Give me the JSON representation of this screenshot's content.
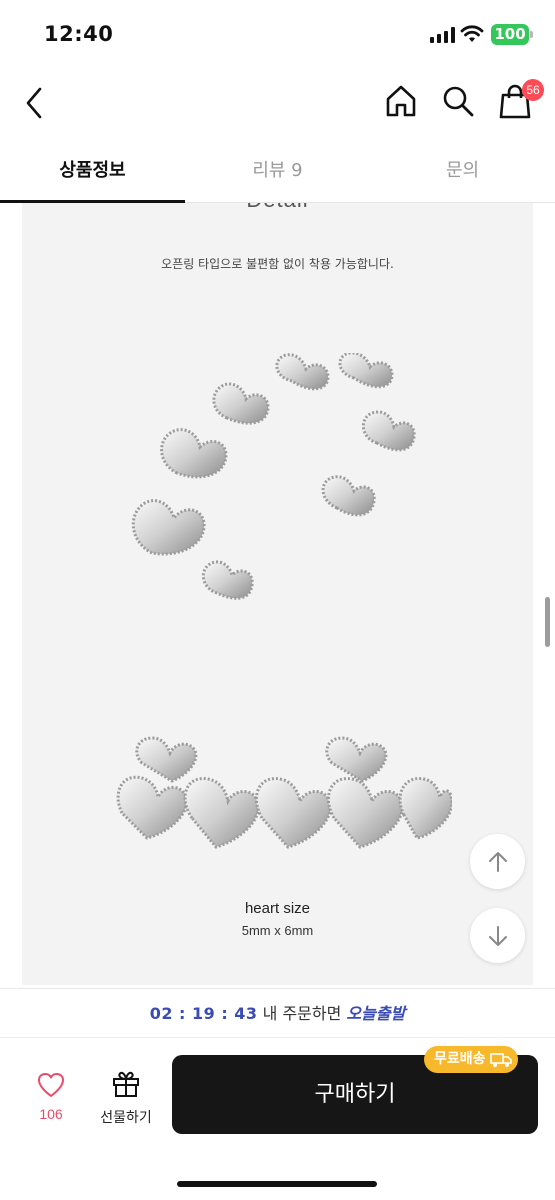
{
  "status_bar": {
    "time": "12:40",
    "battery": "100"
  },
  "header": {
    "cart_badge": "56"
  },
  "tabs": [
    {
      "label": "상품정보",
      "active": true
    },
    {
      "label": "리뷰 9",
      "active": false
    },
    {
      "label": "문의",
      "active": false
    }
  ],
  "content": {
    "detail_title": "Detail",
    "caption": "오픈링 타입으로 불편함 없이 착용 가능합니다.",
    "heart_size_title": "heart size",
    "heart_size_value": "5mm x 6mm"
  },
  "timer": {
    "time": "02 : 19 : 43",
    "text": " 내 주문하면 ",
    "today": "오늘출발"
  },
  "bottom_bar": {
    "like_count": "106",
    "gift_label": "선물하기",
    "buy_label": "구매하기",
    "shipping_badge": "무료배송"
  },
  "colors": {
    "accent_blue": "#3a4bb5",
    "like_pink": "#e64d6a",
    "shipping_badge": "#f7b82c",
    "buy_button": "#161616",
    "badge_red": "#ff4b55"
  }
}
